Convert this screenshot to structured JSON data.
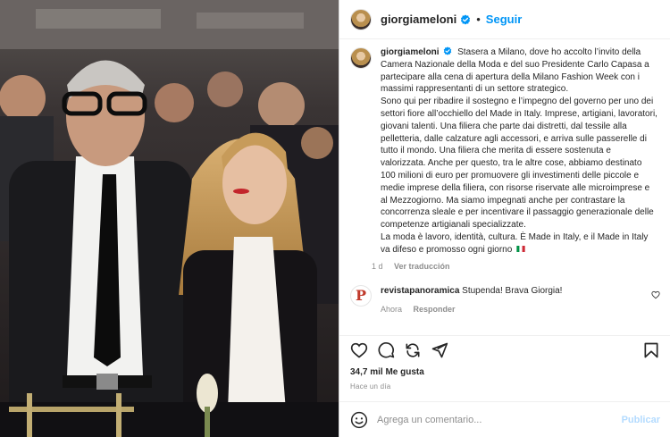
{
  "post": {
    "username": "giorgiameloni",
    "verified": true,
    "follow_label": "Seguir",
    "separator": "•",
    "caption": "Stasera a Milano, dove ho accolto l’invito della Camera Nazionale della Moda e del suo Presidente Carlo Capasa a partecipare alla cena di apertura della Milano Fashion Week con i massimi rappresentanti di un settore strategico.\nSono qui per ribadire il sostegno e l’impegno del governo per uno dei settori fiore all’occhiello del Made in Italy. Imprese, artigiani, lavoratori, giovani talenti. Una filiera che parte dai distretti, dal tessile alla pelletteria, dalle calzature agli accessori, e arriva sulle passerelle di tutto il mondo. Una filiera che merita di essere sostenuta e valorizzata. Anche per questo, tra le altre cose, abbiamo destinato 100 milioni di euro per promuovere gli investimenti delle piccole e medie imprese della filiera, con risorse riservate alle microimprese e al Mezzogiorno. Ma siamo impegnati anche per contrastare la concorrenza sleale e per incentivare il passaggio generazionale delle competenze artigianali specializzate.\nLa moda è lavoro, identità, cultura. È Made in Italy, e il Made in Italy va difeso e promosso ogni giorno",
    "caption_age": "1 d",
    "translate_label": "Ver traducción",
    "likes": "34,7 mil Me gusta",
    "posted": "Hace un día"
  },
  "comments": [
    {
      "username": "revistapanoramica",
      "avatar_letter": "P",
      "text": "Stupenda! Brava Giorgia!",
      "age": "Ahora",
      "reply_label": "Responder"
    }
  ],
  "composer": {
    "placeholder": "Agrega un comentario...",
    "post_label": "Publicar"
  },
  "colors": {
    "accent": "#0095f6",
    "post_disabled": "#b3dbff",
    "verified": "#0095f6"
  },
  "icons": [
    "heart-icon",
    "comment-icon",
    "share-icon",
    "send-icon",
    "bookmark-icon",
    "emoji-icon",
    "more-icon",
    "verified-badge-icon",
    "italian-flag-icon"
  ]
}
